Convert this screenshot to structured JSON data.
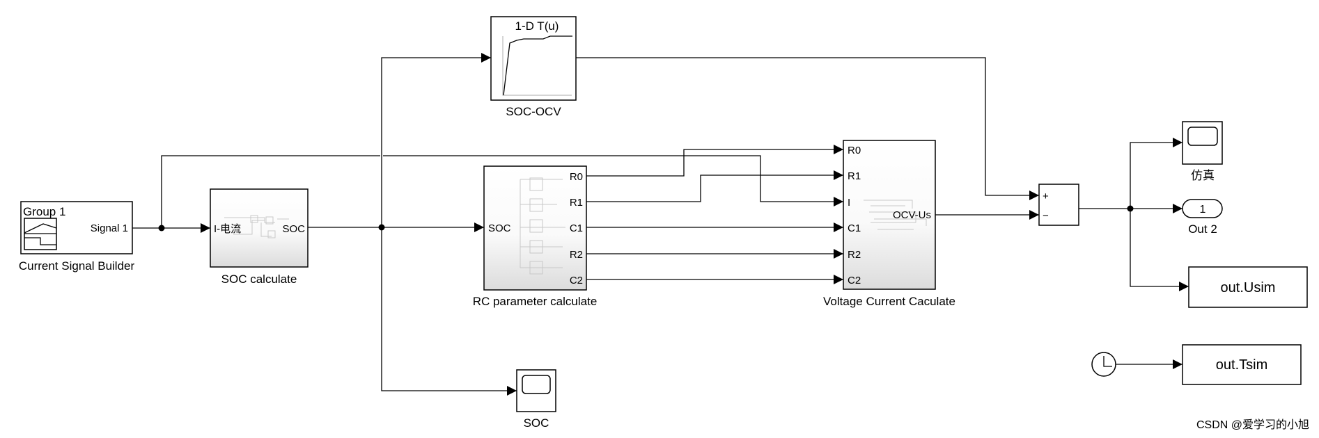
{
  "blocks": {
    "signal_builder": {
      "name": "Current Signal Builder",
      "group": "Group 1",
      "output": "Signal 1"
    },
    "soc_calc": {
      "name": "SOC calculate",
      "input": "I-电流",
      "output": "SOC"
    },
    "soc_ocv": {
      "name": "SOC-OCV",
      "title": "1-D T(u)"
    },
    "rc_param": {
      "name": "RC parameter calculate",
      "input": "SOC",
      "outputs": [
        "R0",
        "R1",
        "C1",
        "R2",
        "C2"
      ]
    },
    "voltage": {
      "name": "Voltage Current Caculate",
      "inputs": [
        "R0",
        "R1",
        "I",
        "C1",
        "R2",
        "C2"
      ],
      "output": "OCV-Us"
    },
    "sum": {
      "plus": "+",
      "minus": "−"
    },
    "scope_sim": {
      "name": "仿真"
    },
    "out2": {
      "name": "Out 2",
      "number": "1"
    },
    "usim": {
      "name": "out.Usim"
    },
    "tsim": {
      "name": "out.Tsim"
    },
    "scope_soc": {
      "name": "SOC"
    }
  },
  "watermark": "CSDN @爱学习的小旭"
}
